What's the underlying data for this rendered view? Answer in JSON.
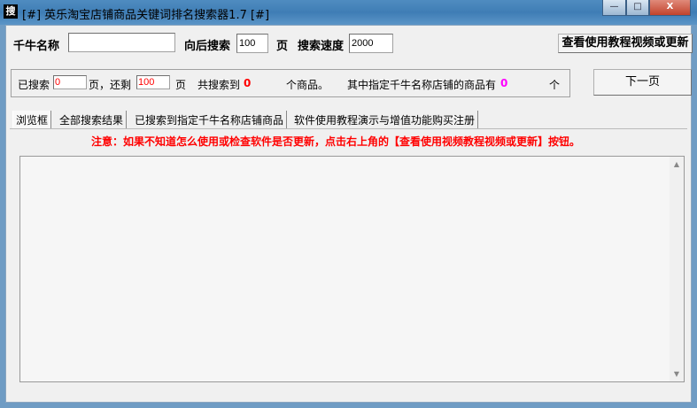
{
  "window": {
    "title": "[#] 英乐淘宝店铺商品关键词排名搜索器1.7 [#]",
    "icon_char": "搜",
    "min": "—",
    "max": "□",
    "close": "X"
  },
  "toolbar": {
    "shop_label": "千牛名称",
    "shop_value": "",
    "pages_label": "向后搜索",
    "pages_value": "100",
    "pages_unit": "页",
    "speed_label": "搜索速度",
    "speed_value": "2000",
    "tutorial_button": "查看使用教程视频或更新"
  },
  "status": {
    "searched_label": "已搜索",
    "searched_value": "0",
    "remaining_label": "页，还剩",
    "remaining_value": "100",
    "page_unit": "页",
    "total_label": "共搜索到",
    "total_value": "0",
    "total_unit": "个商品。",
    "shop_count_label": "其中指定千牛名称店铺的商品有",
    "shop_count_value": "0",
    "shop_count_unit": "个",
    "next_button": "下一页"
  },
  "tabs": [
    "浏览框",
    "全部搜索结果",
    "已搜索到指定千牛名称店铺商品",
    "软件使用教程演示与增值功能购买注册"
  ],
  "notice": "注意：如果不知道怎么使用或检查软件是否更新，点击右上角的【查看使用视频教程视频或更新】按钮。",
  "colors": {
    "red": "#ff0000",
    "magenta": "#ff00ff"
  }
}
